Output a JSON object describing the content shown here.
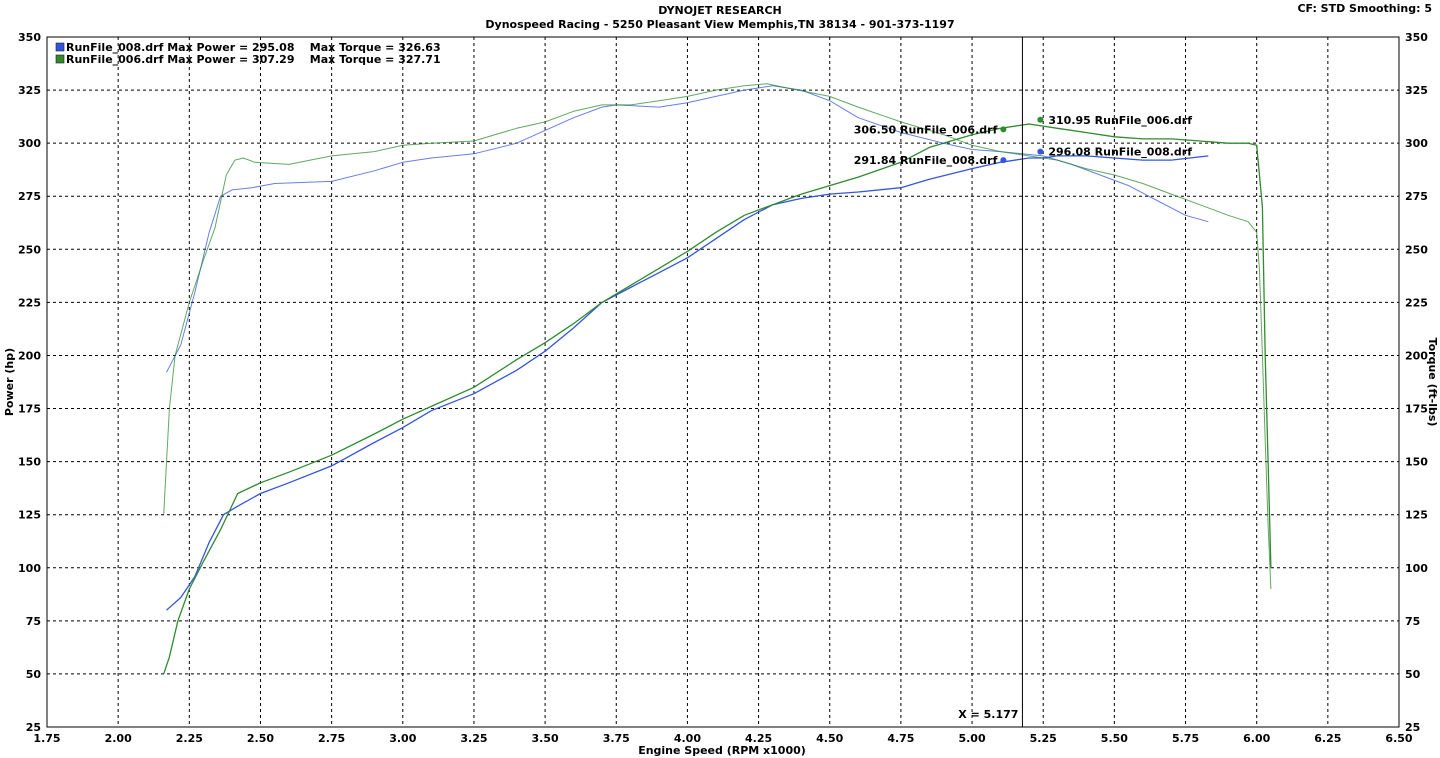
{
  "header": {
    "title": "DYNOJET RESEARCH",
    "subtitle": "Dynospeed  Racing - 5250 Pleasant View Memphis,TN 38134 - 901-373-1197",
    "settings": "CF: STD  Smoothing: 5"
  },
  "colors": {
    "blue": "#3355dd",
    "green": "#2e8b2e"
  },
  "chart_data": {
    "type": "line",
    "xlabel": "Engine Speed (RPM x1000)",
    "ylabel": "Power (hp)",
    "y2label": "Torque (ft-lbs)",
    "xlim": [
      1.75,
      6.5
    ],
    "ylim": [
      25,
      350
    ],
    "y2lim": [
      25,
      350
    ],
    "xticks": [
      "1.75",
      "2.00",
      "2.25",
      "2.50",
      "2.75",
      "3.00",
      "3.25",
      "3.50",
      "3.75",
      "4.00",
      "4.25",
      "4.50",
      "4.75",
      "5.00",
      "5.25",
      "5.50",
      "5.75",
      "6.00",
      "6.25",
      "6.50"
    ],
    "yticks": [
      "350",
      "325",
      "300",
      "275",
      "250",
      "225",
      "200",
      "175",
      "150",
      "125",
      "100",
      "75",
      "50",
      "25"
    ],
    "grid": true,
    "legend_position": "top-left",
    "legend": [
      {
        "text": "RunFile_008.drf Max Power = 295.08    Max Torque = 326.63",
        "color": "blue"
      },
      {
        "text": "RunFile_006.drf Max Power = 307.29    Max Torque = 327.71",
        "color": "green"
      }
    ],
    "cursor": {
      "x": 5.177,
      "label": "X = 5.177"
    },
    "series": [
      {
        "name": "RunFile_008.drf",
        "measure": "power",
        "color": "blue",
        "x": [
          2.17,
          2.22,
          2.27,
          2.32,
          2.37,
          2.42,
          2.5,
          2.6,
          2.75,
          2.9,
          3.0,
          3.1,
          3.25,
          3.4,
          3.5,
          3.6,
          3.7,
          3.8,
          3.9,
          4.0,
          4.1,
          4.2,
          4.3,
          4.4,
          4.5,
          4.6,
          4.75,
          4.85,
          5.0,
          5.1,
          5.2,
          5.25,
          5.3,
          5.4,
          5.5,
          5.6,
          5.7,
          5.83
        ],
        "y": [
          80,
          86,
          96,
          112,
          125,
          129,
          135,
          140,
          148,
          159,
          166,
          174,
          182,
          193,
          202,
          213,
          225,
          232,
          239,
          246,
          255,
          264,
          271,
          274,
          276,
          277,
          279,
          283,
          288,
          291,
          293,
          293,
          294,
          294,
          293,
          292,
          292,
          294
        ]
      },
      {
        "name": "RunFile_006.drf",
        "measure": "power",
        "color": "green",
        "x": [
          2.16,
          2.18,
          2.21,
          2.25,
          2.3,
          2.36,
          2.42,
          2.5,
          2.6,
          2.75,
          2.9,
          3.0,
          3.1,
          3.25,
          3.4,
          3.5,
          3.6,
          3.7,
          3.8,
          3.9,
          4.0,
          4.1,
          4.2,
          4.3,
          4.4,
          4.5,
          4.6,
          4.75,
          4.85,
          5.0,
          5.1,
          5.2,
          5.3,
          5.4,
          5.5,
          5.6,
          5.7,
          5.8,
          5.9,
          5.97,
          6.0,
          6.02,
          6.03,
          6.04,
          6.05
        ],
        "y": [
          50,
          58,
          75,
          90,
          103,
          118,
          135,
          140,
          145,
          153,
          163,
          170,
          176,
          185,
          198,
          206,
          215,
          225,
          233,
          241,
          249,
          258,
          266,
          271,
          276,
          280,
          284,
          291,
          298,
          304,
          307,
          309,
          307,
          305,
          303,
          302,
          302,
          301,
          300,
          300,
          299,
          270,
          200,
          150,
          100
        ]
      },
      {
        "name": "RunFile_008.drf",
        "measure": "torque",
        "color": "blue",
        "x": [
          2.17,
          2.22,
          2.27,
          2.32,
          2.36,
          2.4,
          2.47,
          2.55,
          2.75,
          2.9,
          3.0,
          3.1,
          3.25,
          3.4,
          3.5,
          3.6,
          3.7,
          3.75,
          3.9,
          4.0,
          4.1,
          4.2,
          4.3,
          4.4,
          4.5,
          4.6,
          4.75,
          4.9,
          5.0,
          5.1,
          5.25,
          5.35,
          5.45,
          5.55,
          5.65,
          5.75,
          5.83
        ],
        "y": [
          192,
          205,
          230,
          258,
          275,
          278,
          279,
          281,
          282,
          287,
          291,
          293,
          295,
          300,
          306,
          312,
          317,
          318,
          317,
          319,
          322,
          325,
          327,
          325,
          320,
          312,
          305,
          300,
          297,
          296,
          294,
          290,
          285,
          280,
          273,
          266,
          263
        ]
      },
      {
        "name": "RunFile_006.drf",
        "measure": "torque",
        "color": "green",
        "x": [
          2.16,
          2.18,
          2.2,
          2.25,
          2.3,
          2.34,
          2.38,
          2.41,
          2.44,
          2.48,
          2.6,
          2.75,
          2.9,
          3.0,
          3.1,
          3.25,
          3.4,
          3.5,
          3.6,
          3.7,
          3.8,
          3.9,
          4.0,
          4.1,
          4.2,
          4.28,
          4.35,
          4.5,
          4.6,
          4.75,
          4.9,
          5.0,
          5.1,
          5.2,
          5.3,
          5.4,
          5.5,
          5.6,
          5.7,
          5.8,
          5.9,
          5.97,
          6.0,
          6.01,
          6.02,
          6.03,
          6.04,
          6.05
        ],
        "y": [
          125,
          175,
          200,
          225,
          245,
          260,
          285,
          292,
          293,
          291,
          290,
          294,
          296,
          299,
          300,
          301,
          307,
          310,
          315,
          318,
          318,
          320,
          322,
          325,
          327,
          328,
          326,
          322,
          317,
          310,
          304,
          299,
          296,
          294,
          292,
          288,
          285,
          281,
          276,
          271,
          266,
          263,
          258,
          240,
          200,
          160,
          120,
          90
        ]
      }
    ],
    "annotations": [
      {
        "text": "310.95 RunFile_006.drf",
        "x": 5.24,
        "y": 311,
        "color": "green",
        "side": "right"
      },
      {
        "text": "306.50 RunFile_006.drf",
        "x": 5.11,
        "y": 306.5,
        "color": "green",
        "side": "left"
      },
      {
        "text": "296.08 RunFile_008.drf",
        "x": 5.24,
        "y": 296,
        "color": "blue",
        "side": "right"
      },
      {
        "text": "291.84 RunFile_008.drf",
        "x": 5.11,
        "y": 292,
        "color": "blue",
        "side": "left"
      }
    ]
  }
}
